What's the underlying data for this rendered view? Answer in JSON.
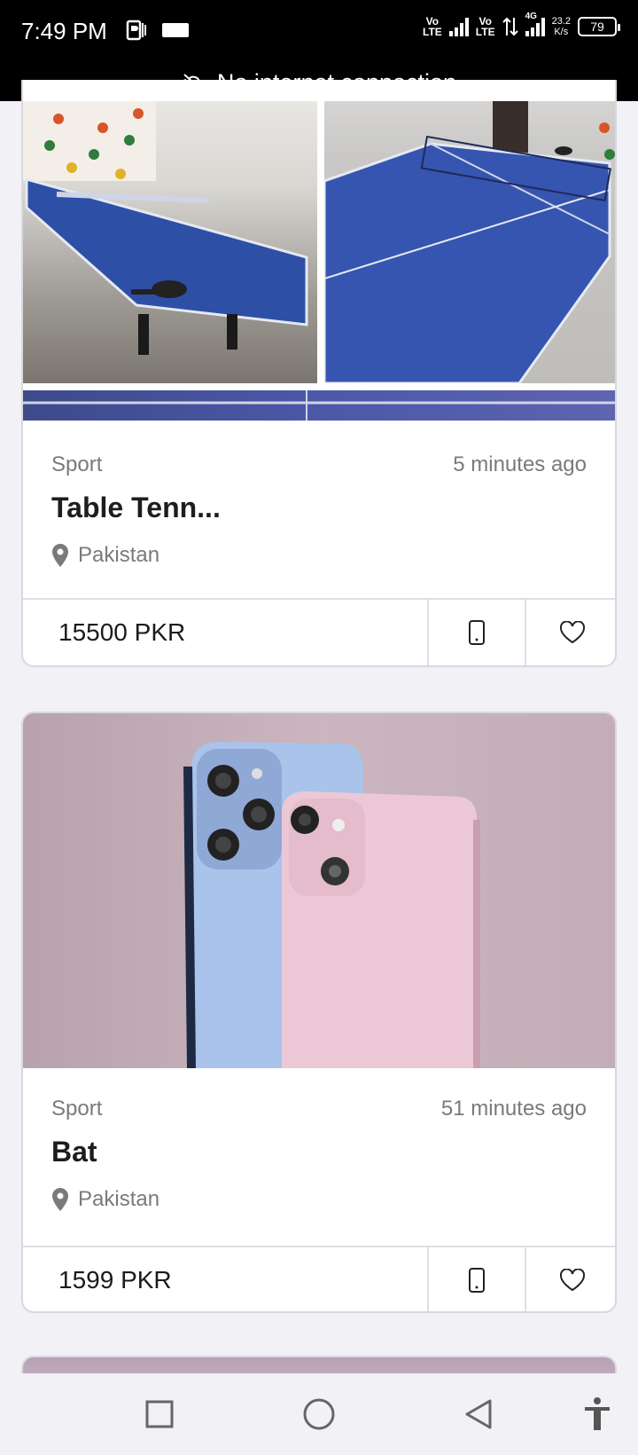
{
  "status_bar": {
    "time": "7:49 PM",
    "lte1_top": "Vo",
    "lte1_bottom": "LTE",
    "lte2_top": "Vo",
    "lte2_bottom": "LTE",
    "net_type": "4G",
    "speed_value": "23.2",
    "speed_unit": "K/s",
    "battery": "79"
  },
  "offline_banner": {
    "text": "No internet connection",
    "icon": "cloud-off-icon"
  },
  "listings": [
    {
      "category": "Sport",
      "time_ago": "5 minutes ago",
      "title": "Table Tenn...",
      "location": "Pakistan",
      "price": "15500 PKR"
    },
    {
      "category": "Sport",
      "time_ago": "51 minutes ago",
      "title": "Bat",
      "location": "Pakistan",
      "price": "1599 PKR"
    }
  ],
  "icons": {
    "location": "location-pin-icon",
    "call": "phone-icon",
    "favorite": "heart-icon"
  },
  "nav_bar": {
    "recent": "square-icon",
    "home": "circle-icon",
    "back": "triangle-back-icon",
    "accessibility": "accessibility-icon"
  },
  "colors": {
    "status_bg": "#000000",
    "page_bg": "#f1f1f6",
    "card_bg": "#ffffff",
    "muted_text": "#7a7a7a"
  }
}
